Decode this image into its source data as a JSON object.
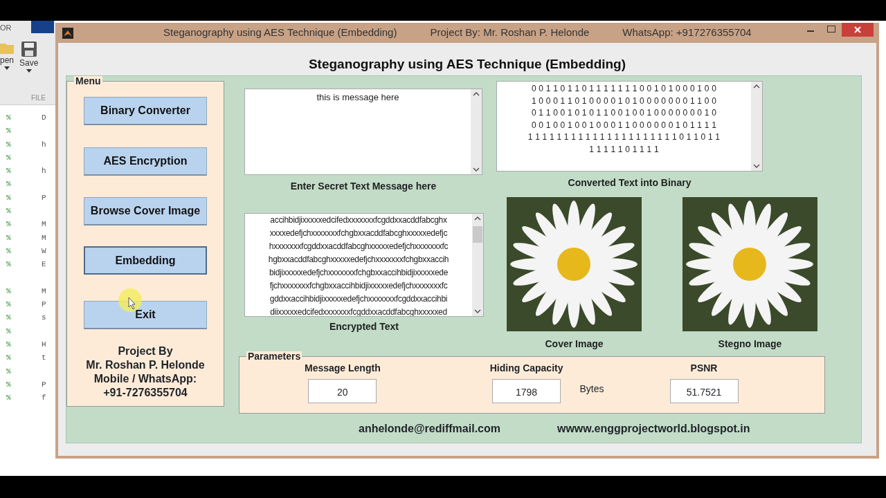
{
  "editor": {
    "tab_label": "OR",
    "toolbar": [
      {
        "kind": "folder",
        "label": "pen"
      },
      {
        "kind": "save",
        "label": "Save"
      }
    ],
    "section_label": "FILE",
    "code_lines": [
      {
        "mark": "%",
        "text": "D"
      },
      {
        "mark": "%"
      },
      {
        "mark": "%",
        "text": "h"
      },
      {
        "mark": "%"
      },
      {
        "mark": "%",
        "text": "h"
      },
      {
        "mark": "%"
      },
      {
        "mark": "%",
        "text": "P"
      },
      {
        "mark": "%"
      },
      {
        "mark": "%",
        "text": "M"
      },
      {
        "mark": "%",
        "text": "M"
      },
      {
        "mark": "%",
        "text": "W"
      },
      {
        "mark": "%",
        "text": "E"
      },
      {
        "mark": "%",
        "text": "M",
        "gap_before": true
      },
      {
        "mark": "%",
        "text": "P"
      },
      {
        "mark": "%",
        "text": "s"
      },
      {
        "mark": "%"
      },
      {
        "mark": "%",
        "text": "H"
      },
      {
        "mark": "%",
        "text": "t"
      },
      {
        "mark": "%"
      },
      {
        "mark": "%",
        "text": "P"
      },
      {
        "mark": "%",
        "text": "f"
      }
    ]
  },
  "window": {
    "title_parts": [
      "Steganography using AES Technique  (Embedding)",
      "Project By: Mr. Roshan P. Helonde",
      "WhatsApp: +917276355704"
    ]
  },
  "heading": "Steganography using AES Technique (Embedding)",
  "menu": {
    "legend": "Menu",
    "buttons": [
      {
        "label": "Binary Converter",
        "focused": false
      },
      {
        "label": "AES Encryption",
        "focused": false
      },
      {
        "label": "Browse Cover Image",
        "focused": false
      },
      {
        "label": "Embedding",
        "focused": true
      },
      {
        "label": "Exit",
        "focused": false
      }
    ],
    "credits": [
      "Project By",
      "Mr. Roshan P. Helonde",
      "Mobile / WhatsApp:",
      "+91-7276355704"
    ]
  },
  "secret_message": {
    "value": "this is message here",
    "caption": "Enter Secret Text Message here"
  },
  "binary": {
    "lines": [
      "0 0 1 1 0 1 1 0 1 1 1 1 1 1 1 0 0 1 0 1 0 0 0 1 0 0",
      "1 0 0 0 1 1 0 1 0 0 0 0 1 0 1 0 0 0 0 0 0 0 1 1 0 0",
      "0 1 1 0 0 1 0 1 0 1 1 0 0 1 0 0 1 0 0 0 0 0 0 0 1 0",
      "0 0 1 0 0 1 0 0 1 0 0 0 1 1 0 0 0 0 0 0 1 0 1 1 1 1",
      "1 1 1 1 1 1 1 1 1 1 1 1 1 1 1 1 1 1 1 1 1 0 1 1 0 1 1",
      "1 1 1 1 1 0 1 1 1 1"
    ],
    "caption": "Converted Text into Binary"
  },
  "encrypted": {
    "lines": [
      "accihbidjixxxxxedcifedxxxxxxxfcgddxxacddfabcghx",
      "xxxxedefjchxxxxxxxfchgbxxacddfabcghxxxxxedefjc",
      "hxxxxxxxfcgddxxacddfabcghxxxxxedefjchxxxxxxxfc",
      "hgbxxacddfabcghxxxxxedefjchxxxxxxxfchgbxxaccih",
      "bidjixxxxxedefjchxxxxxxxfchgbxxaccihbidjixxxxxede",
      "fjchxxxxxxxfchgbxxaccihbidjixxxxxedefjchxxxxxxxfc",
      "gddxxaccihbidjixxxxxedefjchxxxxxxxfcgddxxaccihbi",
      "diixxxxxedcifedxxxxxxxfcgddxxacddfabcghxxxxxed"
    ],
    "caption": "Encrypted Text"
  },
  "images": [
    {
      "caption": "Cover Image"
    },
    {
      "caption": "Stegno Image"
    }
  ],
  "parameters": {
    "legend": "Parameters",
    "fields": [
      {
        "label": "Message Length",
        "value": "20"
      },
      {
        "label": "Hiding Capacity",
        "value": "1798",
        "unit": "Bytes"
      },
      {
        "label": "PSNR",
        "value": "51.7521"
      }
    ]
  },
  "footer": [
    "anhelonde@rediffmail.com",
    "wwww.enggprojectworld.blogspot.in"
  ]
}
